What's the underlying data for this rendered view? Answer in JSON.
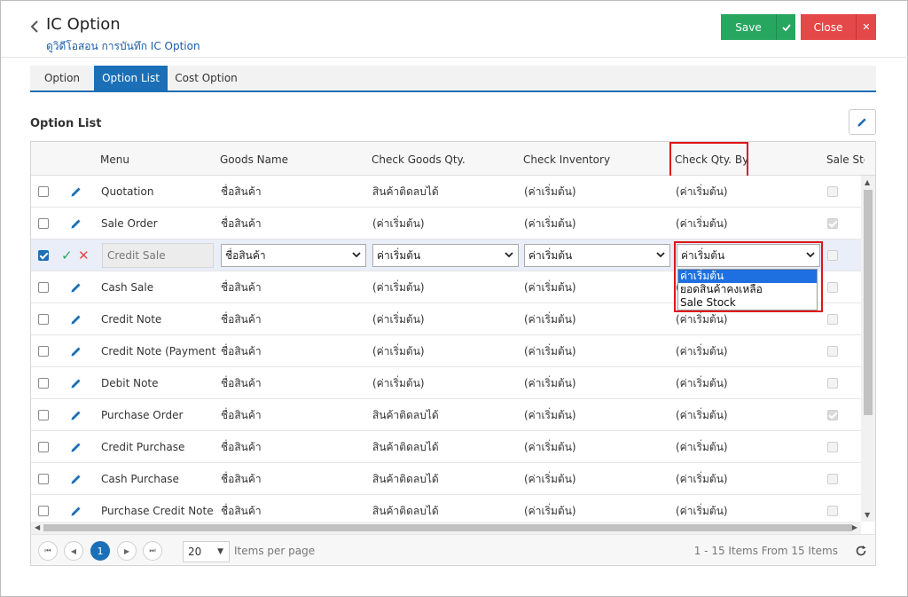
{
  "header": {
    "title": "IC Option",
    "subtitle": "ดูวิดีโอสอน การบันทึก IC Option",
    "save_label": "Save",
    "close_label": "Close"
  },
  "tabs": [
    {
      "label": "Option",
      "active": false
    },
    {
      "label": "Option List",
      "active": true
    },
    {
      "label": "Cost Option",
      "active": false
    }
  ],
  "section": {
    "title": "Option List"
  },
  "table": {
    "columns": [
      "Menu",
      "Goods Name",
      "Check Goods Qty.",
      "Check Inventory",
      "Check Qty. By",
      "Sale Sto"
    ],
    "rows": [
      {
        "menu": "Quotation",
        "goods_name": "ชื่อสินค้า",
        "check_goods_qty": "สินค้าติดลบได้",
        "check_inventory": "(ค่าเริ่มต้น)",
        "check_qty_by": "(ค่าเริ่มต้น)",
        "sale_stock": false
      },
      {
        "menu": "Sale Order",
        "goods_name": "ชื่อสินค้า",
        "check_goods_qty": "(ค่าเริ่มต้น)",
        "check_inventory": "(ค่าเริ่มต้น)",
        "check_qty_by": "(ค่าเริ่มต้น)",
        "sale_stock": true
      },
      {
        "menu": "Credit Sale",
        "goods_name": "ชื่อสินค้า",
        "check_goods_qty": "ค่าเริ่มต้น",
        "check_inventory": "ค่าเริ่มต้น",
        "check_qty_by": "ค่าเริ่มต้น",
        "sale_stock": false,
        "editing": true,
        "row_checked": true
      },
      {
        "menu": "Cash Sale",
        "goods_name": "ชื่อสินค้า",
        "check_goods_qty": "(ค่าเริ่มต้น)",
        "check_inventory": "(ค่าเริ่มต้น)",
        "check_qty_by": "(ค่าเริ่มต้น)",
        "sale_stock": false
      },
      {
        "menu": "Credit Note",
        "goods_name": "ชื่อสินค้า",
        "check_goods_qty": "(ค่าเริ่มต้น)",
        "check_inventory": "(ค่าเริ่มต้น)",
        "check_qty_by": "(ค่าเริ่มต้น)",
        "sale_stock": false
      },
      {
        "menu": "Credit Note (Payment)",
        "goods_name": "ชื่อสินค้า",
        "check_goods_qty": "(ค่าเริ่มต้น)",
        "check_inventory": "(ค่าเริ่มต้น)",
        "check_qty_by": "(ค่าเริ่มต้น)",
        "sale_stock": false
      },
      {
        "menu": "Debit Note",
        "goods_name": "ชื่อสินค้า",
        "check_goods_qty": "(ค่าเริ่มต้น)",
        "check_inventory": "(ค่าเริ่มต้น)",
        "check_qty_by": "(ค่าเริ่มต้น)",
        "sale_stock": false
      },
      {
        "menu": "Purchase Order",
        "goods_name": "ชื่อสินค้า",
        "check_goods_qty": "สินค้าติดลบได้",
        "check_inventory": "(ค่าเริ่มต้น)",
        "check_qty_by": "(ค่าเริ่มต้น)",
        "sale_stock": true
      },
      {
        "menu": "Credit Purchase",
        "goods_name": "ชื่อสินค้า",
        "check_goods_qty": "สินค้าติดลบได้",
        "check_inventory": "(ค่าเริ่มต้น)",
        "check_qty_by": "(ค่าเริ่มต้น)",
        "sale_stock": false
      },
      {
        "menu": "Cash Purchase",
        "goods_name": "ชื่อสินค้า",
        "check_goods_qty": "สินค้าติดลบได้",
        "check_inventory": "(ค่าเริ่มต้น)",
        "check_qty_by": "(ค่าเริ่มต้น)",
        "sale_stock": false
      },
      {
        "menu": "Purchase Credit Note",
        "goods_name": "ชื่อสินค้า",
        "check_goods_qty": "สินค้าติดลบได้",
        "check_inventory": "(ค่าเริ่มต้น)",
        "check_qty_by": "(ค่าเริ่มต้น)",
        "sale_stock": false
      }
    ]
  },
  "dropdown": {
    "options": [
      "ค่าเริ่มต้น",
      "ยอดสินค้าคงเหลือ",
      "Sale Stock"
    ],
    "selected_index": 0
  },
  "pager": {
    "current_page": "1",
    "page_size": "20",
    "page_size_label": "Items per page",
    "info": "1 - 15 Items From 15 Items"
  },
  "colors": {
    "save": "#27a660",
    "close": "#e54848",
    "accent": "#1b6fb7",
    "highlight": "#e0141a"
  }
}
